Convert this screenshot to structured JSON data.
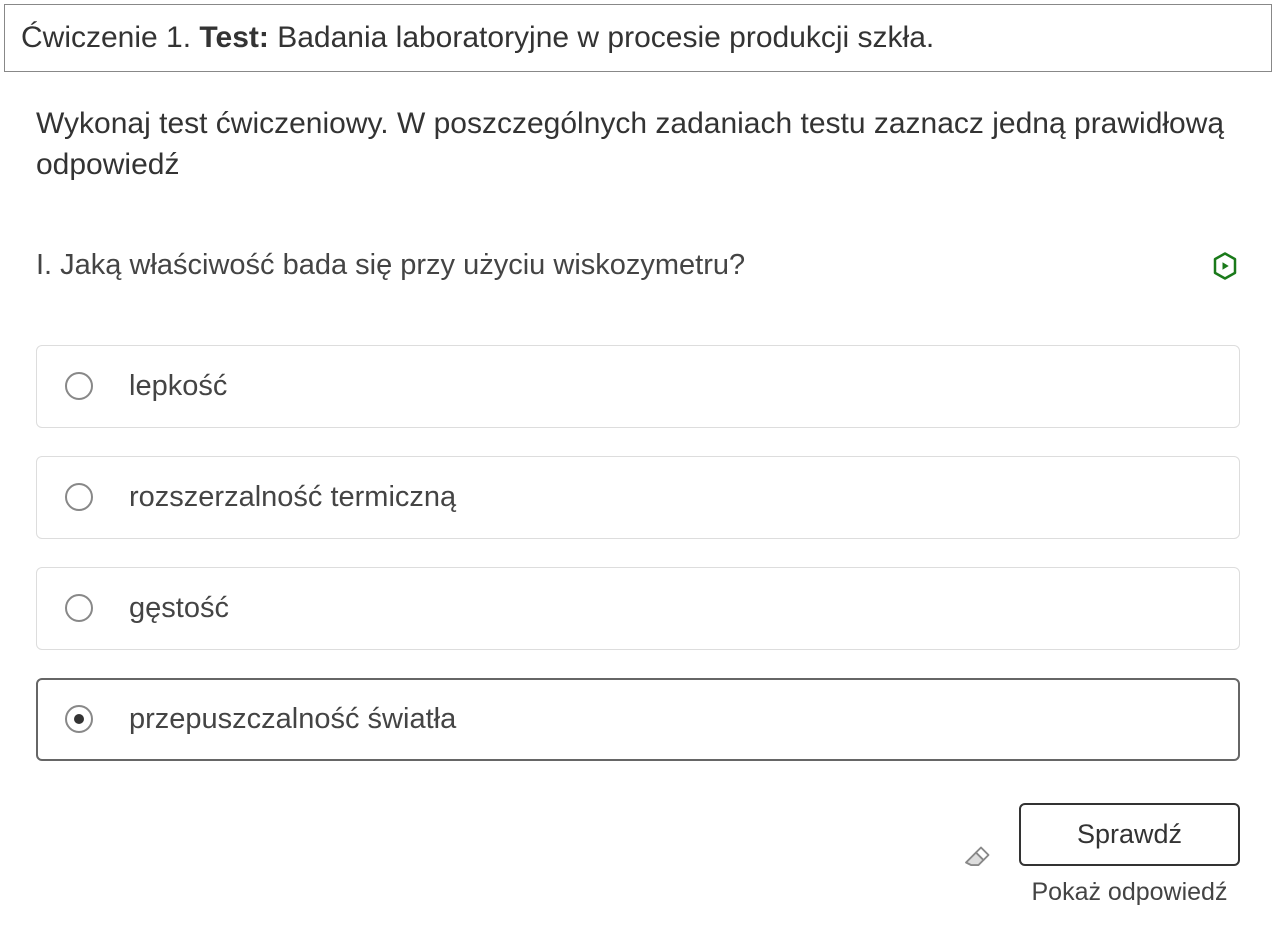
{
  "header": {
    "exercise_number": "Ćwiczenie 1.",
    "test_label": "Test:",
    "test_title": "Badania laboratoryjne w procesie produkcji szkła."
  },
  "instructions": "Wykonaj test ćwiczeniowy. W poszczególnych zadaniach testu zaznacz jedną prawidłową odpowiedź",
  "question": {
    "text": "I. Jaką właściwość bada się przy użyciu wiskozymetru?",
    "status_icon": "hexagon-check-icon"
  },
  "options": [
    {
      "label": "lepkość",
      "selected": false
    },
    {
      "label": "rozszerzalność termiczną",
      "selected": false
    },
    {
      "label": "gęstość",
      "selected": false
    },
    {
      "label": "przepuszczalność światła",
      "selected": true
    }
  ],
  "footer": {
    "check_button": "Sprawdź",
    "show_answer": "Pokaż odpowiedź"
  }
}
